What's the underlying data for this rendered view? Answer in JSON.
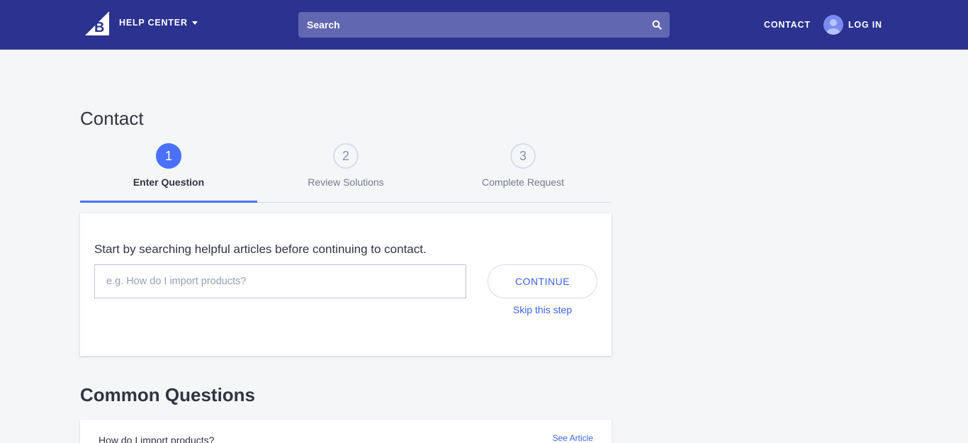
{
  "header": {
    "logo_icon": "bigcommerce-logo-icon",
    "help_center_label": "HELP CENTER",
    "search_placeholder": "Search",
    "search_icon": "search-icon",
    "contact_label": "CONTACT",
    "login_label": "LOG IN",
    "avatar_icon": "user-avatar-icon",
    "background_color": "#2c328f"
  },
  "page": {
    "title": "Contact"
  },
  "steps": [
    {
      "number": "1",
      "label": "Enter Question",
      "active": true
    },
    {
      "number": "2",
      "label": "Review Solutions",
      "active": false
    },
    {
      "number": "3",
      "label": "Complete Request",
      "active": false
    }
  ],
  "question_card": {
    "intro": "Start by searching helpful articles before continuing to contact.",
    "input_placeholder": "e.g. How do I import products?",
    "input_value": "",
    "continue_label": "CONTINUE",
    "skip_label": "Skip this step"
  },
  "common_questions": {
    "title": "Common Questions",
    "items": [
      {
        "question": "How do I import products?",
        "link_label": "See Article"
      }
    ]
  },
  "colors": {
    "accent": "#4b71fc",
    "link": "#3c64f4",
    "page_background": "#f5f6f8"
  }
}
